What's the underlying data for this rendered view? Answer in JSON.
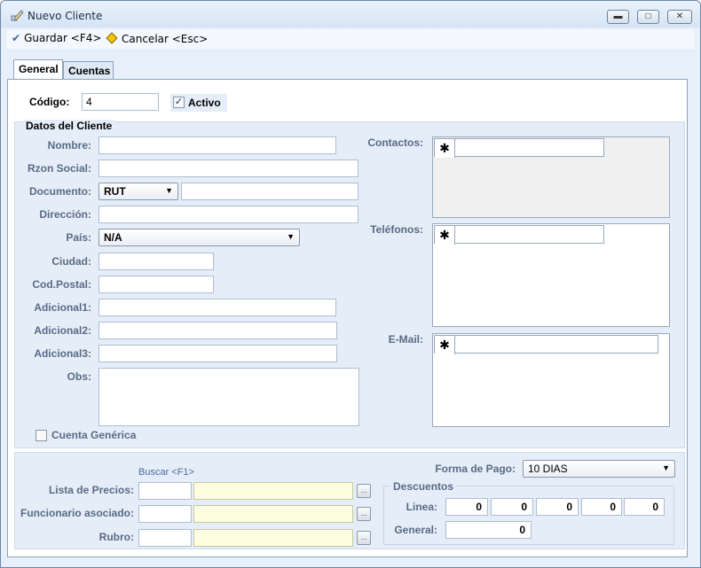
{
  "window": {
    "title": "Nuevo Cliente",
    "minimize_glyph": "▬",
    "maximize_glyph": "□",
    "close_glyph": "✕"
  },
  "toolbar": {
    "save_label": "Guardar <F4>",
    "cancel_label": "Cancelar <Esc>",
    "save_icon_glyph": "✔",
    "cancel_icon_glyph": "⛌"
  },
  "tabs": [
    {
      "label": "General",
      "active": true
    },
    {
      "label": "Cuentas",
      "active": false
    }
  ],
  "general": {
    "codigo_label": "Código:",
    "codigo_value": "4",
    "activo_label": "Activo",
    "activo_checked": true,
    "datos_group_label": "Datos del Cliente",
    "fields": {
      "nombre": {
        "label": "Nombre:",
        "value": ""
      },
      "razon_social": {
        "label": "Rzon Social:",
        "value": ""
      },
      "documento": {
        "label": "Documento:",
        "type_value": "RUT",
        "value": ""
      },
      "direccion": {
        "label": "Dirección:",
        "value": ""
      },
      "pais": {
        "label": "País:",
        "value": "N/A"
      },
      "ciudad": {
        "label": "Ciudad:",
        "value": ""
      },
      "cod_postal": {
        "label": "Cod.Postal:",
        "value": ""
      },
      "adicional1": {
        "label": "Adicional1:",
        "value": ""
      },
      "adicional2": {
        "label": "Adicional2:",
        "value": ""
      },
      "adicional3": {
        "label": "Adicional3:",
        "value": ""
      },
      "obs": {
        "label": "Obs:",
        "value": ""
      }
    },
    "contactos_label": "Contactos:",
    "telefonos_label": "Teléfonos:",
    "email_label": "E-Mail:",
    "new_row_glyph": "✱",
    "cuenta_generica_label": "Cuenta Genérica",
    "cuenta_generica_checked": false
  },
  "bottom": {
    "buscar_hint": "Buscar <F1>",
    "lookup_glyph": "...",
    "lista_precios_label": "Lista de Precios:",
    "funcionario_label": "Funcionario asociado:",
    "rubro_label": "Rubro:",
    "forma_pago_label": "Forma de Pago:",
    "forma_pago_value": "10 DIAS",
    "descuentos_label": "Descuentos",
    "linea_label": "Linea:",
    "linea_values": [
      "0",
      "0",
      "0",
      "0",
      "0"
    ],
    "general_label": "General:",
    "general_value": "0"
  },
  "colors": {
    "label_blue": "#5a6a85",
    "window_bg": "#e7f0fa",
    "lookup_field_bg": "#fdfde0"
  }
}
